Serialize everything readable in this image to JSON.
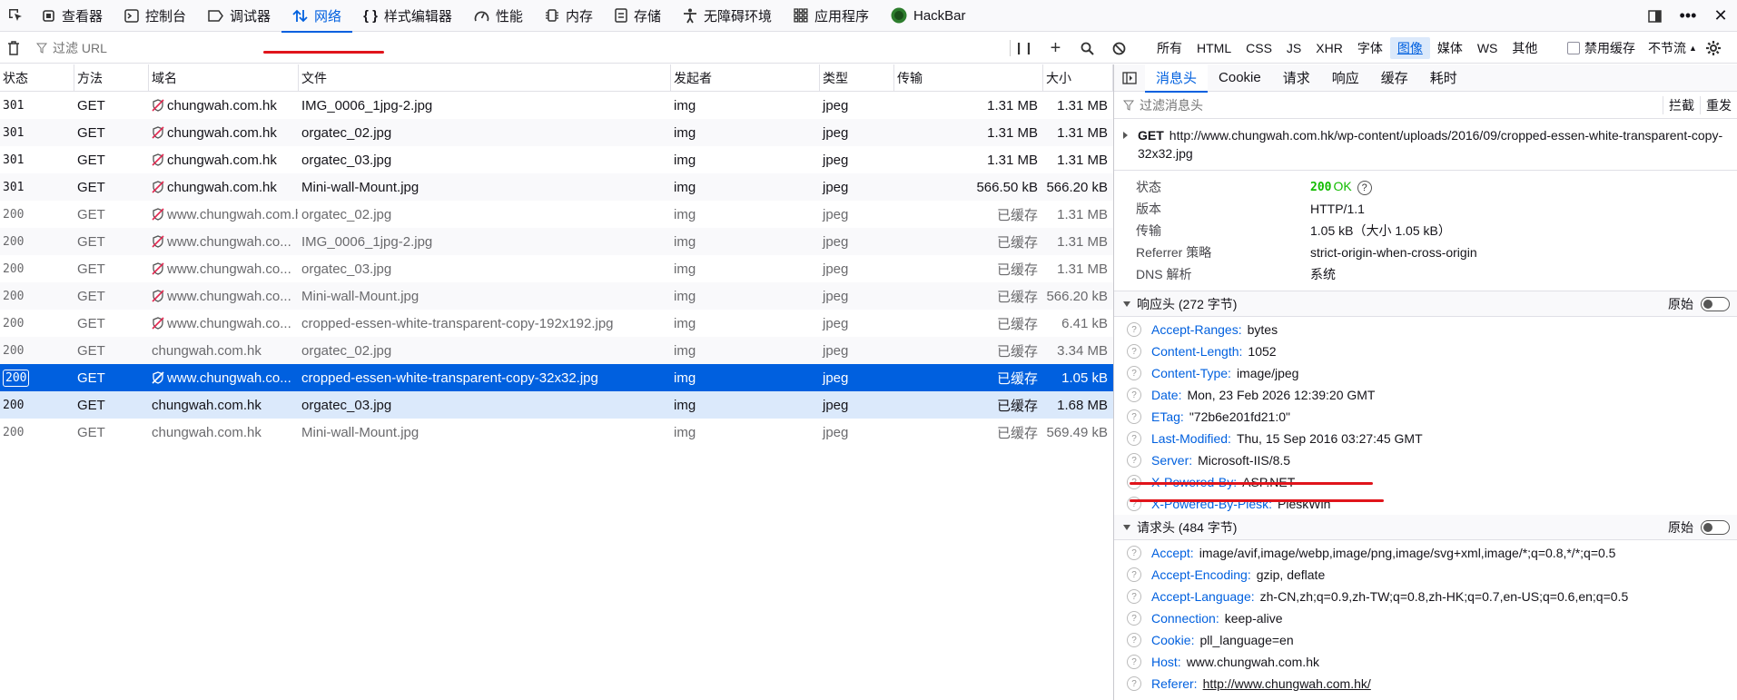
{
  "toolbar": {
    "tabs": [
      {
        "label": "查看器",
        "icon": "inspector-icon"
      },
      {
        "label": "控制台",
        "icon": "console-icon"
      },
      {
        "label": "调试器",
        "icon": "debugger-icon"
      },
      {
        "label": "网络",
        "icon": "network-icon",
        "active": true
      },
      {
        "label": "样式编辑器",
        "icon": "style-editor-icon"
      },
      {
        "label": "性能",
        "icon": "performance-icon"
      },
      {
        "label": "内存",
        "icon": "memory-icon"
      },
      {
        "label": "存储",
        "icon": "storage-icon"
      },
      {
        "label": "无障碍环境",
        "icon": "accessibility-icon"
      },
      {
        "label": "应用程序",
        "icon": "application-icon"
      },
      {
        "label": "HackBar",
        "icon": "hackbar-icon"
      }
    ]
  },
  "filter": {
    "placeholder": "过滤 URL",
    "types": [
      "所有",
      "HTML",
      "CSS",
      "JS",
      "XHR",
      "字体",
      "图像",
      "媒体",
      "WS",
      "其他"
    ],
    "active_type": "图像",
    "disable_cache": "禁用缓存",
    "throttle": "不节流"
  },
  "columns": [
    "状态",
    "方法",
    "域名",
    "文件",
    "发起者",
    "类型",
    "传输",
    "大小"
  ],
  "rows": [
    {
      "status": "301",
      "method": "GET",
      "domain": "chungwah.com.hk",
      "shield": true,
      "file": "IMG_0006_1jpg-2.jpg",
      "initiator": "img",
      "type": "jpeg",
      "transfer": "1.31 MB",
      "size": "1.31 MB"
    },
    {
      "status": "301",
      "method": "GET",
      "domain": "chungwah.com.hk",
      "shield": true,
      "file": "orgatec_02.jpg",
      "initiator": "img",
      "type": "jpeg",
      "transfer": "1.31 MB",
      "size": "1.31 MB"
    },
    {
      "status": "301",
      "method": "GET",
      "domain": "chungwah.com.hk",
      "shield": true,
      "file": "orgatec_03.jpg",
      "initiator": "img",
      "type": "jpeg",
      "transfer": "1.31 MB",
      "size": "1.31 MB"
    },
    {
      "status": "301",
      "method": "GET",
      "domain": "chungwah.com.hk",
      "shield": true,
      "file": "Mini-wall-Mount.jpg",
      "initiator": "img",
      "type": "jpeg",
      "transfer": "566.50 kB",
      "size": "566.20 kB"
    },
    {
      "status": "200",
      "method": "GET",
      "domain": "www.chungwah.com.hk",
      "shield": true,
      "file": "orgatec_02.jpg",
      "initiator": "img",
      "type": "jpeg",
      "transfer": "已缓存",
      "size": "1.31 MB",
      "cached": true
    },
    {
      "status": "200",
      "method": "GET",
      "domain": "www.chungwah.co...",
      "shield": true,
      "file": "IMG_0006_1jpg-2.jpg",
      "initiator": "img",
      "type": "jpeg",
      "transfer": "已缓存",
      "size": "1.31 MB",
      "cached": true
    },
    {
      "status": "200",
      "method": "GET",
      "domain": "www.chungwah.co...",
      "shield": true,
      "file": "orgatec_03.jpg",
      "initiator": "img",
      "type": "jpeg",
      "transfer": "已缓存",
      "size": "1.31 MB",
      "cached": true
    },
    {
      "status": "200",
      "method": "GET",
      "domain": "www.chungwah.co...",
      "shield": true,
      "file": "Mini-wall-Mount.jpg",
      "initiator": "img",
      "type": "jpeg",
      "transfer": "已缓存",
      "size": "566.20 kB",
      "cached": true
    },
    {
      "status": "200",
      "method": "GET",
      "domain": "www.chungwah.co...",
      "shield": true,
      "file": "cropped-essen-white-transparent-copy-192x192.jpg",
      "initiator": "img",
      "type": "jpeg",
      "transfer": "已缓存",
      "size": "6.41 kB",
      "cached": true
    },
    {
      "status": "200",
      "method": "GET",
      "domain": "chungwah.com.hk",
      "shield": false,
      "file": "orgatec_02.jpg",
      "initiator": "img",
      "type": "jpeg",
      "transfer": "已缓存",
      "size": "3.34 MB",
      "cached": true
    },
    {
      "status": "200",
      "method": "GET",
      "domain": "www.chungwah.co...",
      "shield": true,
      "file": "cropped-essen-white-transparent-copy-32x32.jpg",
      "initiator": "img",
      "type": "jpeg",
      "transfer": "已缓存",
      "size": "1.05 kB",
      "selected": true
    },
    {
      "status": "200",
      "method": "GET",
      "domain": "chungwah.com.hk",
      "shield": false,
      "file": "orgatec_03.jpg",
      "initiator": "img",
      "type": "jpeg",
      "transfer": "已缓存",
      "size": "1.68 MB",
      "highlight": true
    },
    {
      "status": "200",
      "method": "GET",
      "domain": "chungwah.com.hk",
      "shield": false,
      "file": "Mini-wall-Mount.jpg",
      "initiator": "img",
      "type": "jpeg",
      "transfer": "已缓存",
      "size": "569.49 kB",
      "cached": true
    }
  ],
  "details": {
    "tabs": [
      "消息头",
      "Cookie",
      "请求",
      "响应",
      "缓存",
      "耗时"
    ],
    "active_tab": "消息头",
    "filter_placeholder": "过滤消息头",
    "block_label": "拦截",
    "resend_label": "重发",
    "request": {
      "method": "GET",
      "url": "http://www.chungwah.com.hk/wp-content/uploads/2016/09/cropped-essen-white-transparent-copy-32x32.jpg"
    },
    "summary": {
      "status_key": "状态",
      "status_code": "200",
      "status_text": "OK",
      "version_key": "版本",
      "version": "HTTP/1.1",
      "transfer_key": "传输",
      "transfer": "1.05 kB（大小 1.05 kB）",
      "referrer_key": "Referrer 策略",
      "referrer": "strict-origin-when-cross-origin",
      "dns_key": "DNS 解析",
      "dns": "系统"
    },
    "response_headers_title": "响应头 (272 字节)",
    "raw_label": "原始",
    "response_headers": [
      {
        "name": "Accept-Ranges:",
        "value": "bytes"
      },
      {
        "name": "Content-Length:",
        "value": "1052"
      },
      {
        "name": "Content-Type:",
        "value": "image/jpeg"
      },
      {
        "name": "Date:",
        "value": "Mon, 23 Feb 2026 12:39:20 GMT"
      },
      {
        "name": "ETag:",
        "value": "\"72b6e201fd21:0\""
      },
      {
        "name": "Last-Modified:",
        "value": "Thu, 15 Sep 2016 03:27:45 GMT"
      },
      {
        "name": "Server:",
        "value": "Microsoft-IIS/8.5"
      },
      {
        "name": "X-Powered-By:",
        "value": "ASP.NET"
      },
      {
        "name": "X-Powered-By-Plesk:",
        "value": "PleskWin"
      }
    ],
    "request_headers_title": "请求头 (484 字节)",
    "request_headers": [
      {
        "name": "Accept:",
        "value": "image/avif,image/webp,image/png,image/svg+xml,image/*;q=0.8,*/*;q=0.5"
      },
      {
        "name": "Accept-Encoding:",
        "value": "gzip, deflate"
      },
      {
        "name": "Accept-Language:",
        "value": "zh-CN,zh;q=0.9,zh-TW;q=0.8,zh-HK;q=0.7,en-US;q=0.6,en;q=0.5"
      },
      {
        "name": "Connection:",
        "value": "keep-alive"
      },
      {
        "name": "Cookie:",
        "value": "pll_language=en"
      },
      {
        "name": "Host:",
        "value": "www.chungwah.com.hk"
      },
      {
        "name": "Referer:",
        "value": "http://www.chungwah.com.hk/",
        "link": true
      }
    ]
  },
  "colors": {
    "accent": "#0060df",
    "ok": "#12bc00",
    "annotation": "#e0141b"
  }
}
